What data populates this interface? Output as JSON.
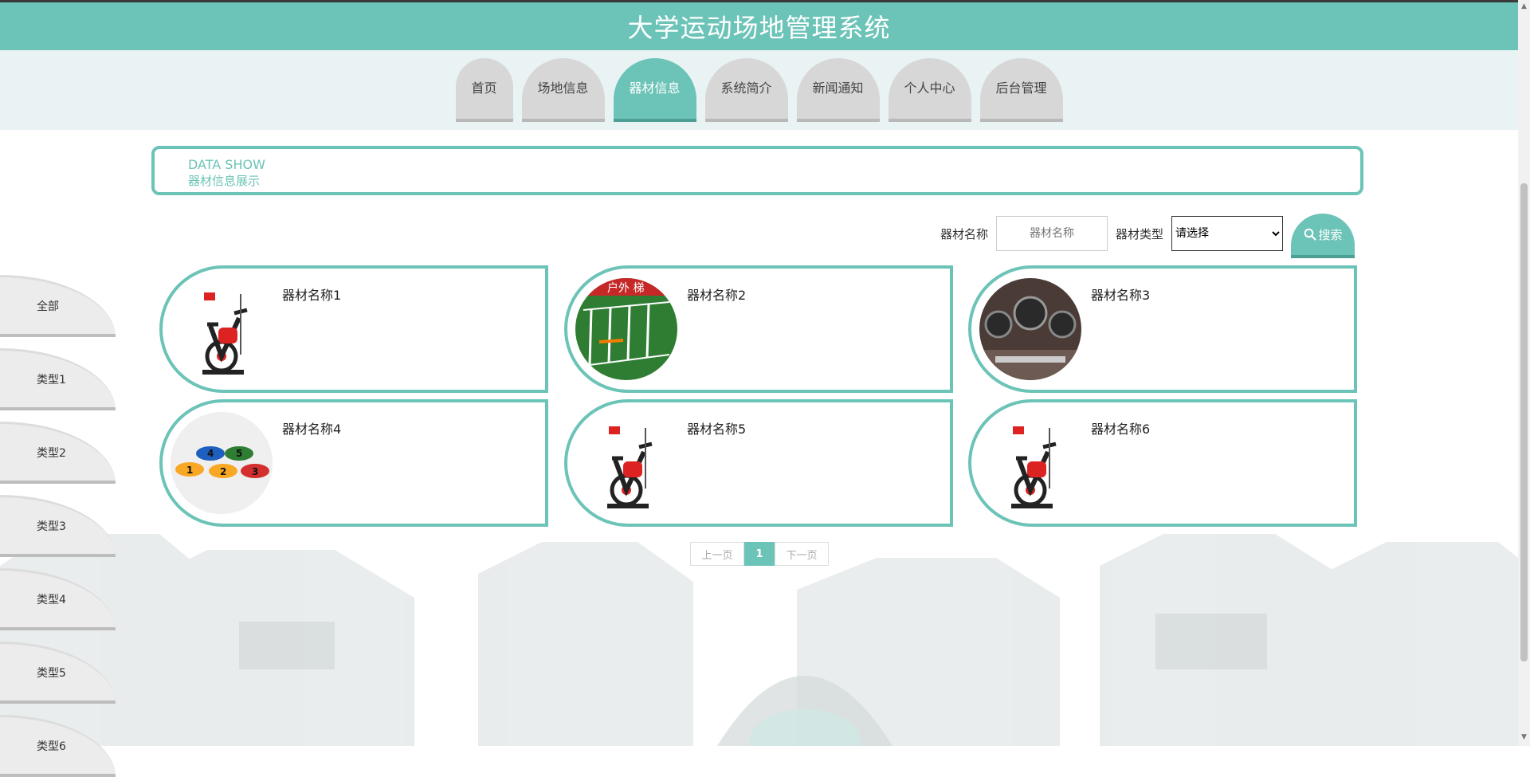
{
  "header": {
    "title": "大学运动场地管理系统"
  },
  "nav": [
    {
      "label": "首页"
    },
    {
      "label": "场地信息"
    },
    {
      "label": "器材信息",
      "active": true
    },
    {
      "label": "系统简介"
    },
    {
      "label": "新闻通知"
    },
    {
      "label": "个人中心"
    },
    {
      "label": "后台管理"
    }
  ],
  "banner": {
    "en": "DATA SHOW",
    "cn": "器材信息展示"
  },
  "search": {
    "name_label": "器材名称",
    "name_placeholder": "器材名称",
    "type_label": "器材类型",
    "type_selected": "请选择",
    "button_label": "搜索"
  },
  "categories": [
    "全部",
    "类型1",
    "类型2",
    "类型3",
    "类型4",
    "类型5",
    "类型6"
  ],
  "items": [
    {
      "name": "器材名称1",
      "image": "spin-bike"
    },
    {
      "name": "器材名称2",
      "image": "agility-ladder-turf"
    },
    {
      "name": "器材名称3",
      "image": "gym-weights"
    },
    {
      "name": "器材名称4",
      "image": "number-discs"
    },
    {
      "name": "器材名称5",
      "image": "spin-bike"
    },
    {
      "name": "器材名称6",
      "image": "spin-bike"
    }
  ],
  "pagination": {
    "prev": "上一页",
    "current": "1",
    "next": "下一页"
  },
  "colors": {
    "accent": "#6cc3b7",
    "accent_dark": "#4d9e93",
    "tab_idle": "#d7d7d7"
  }
}
